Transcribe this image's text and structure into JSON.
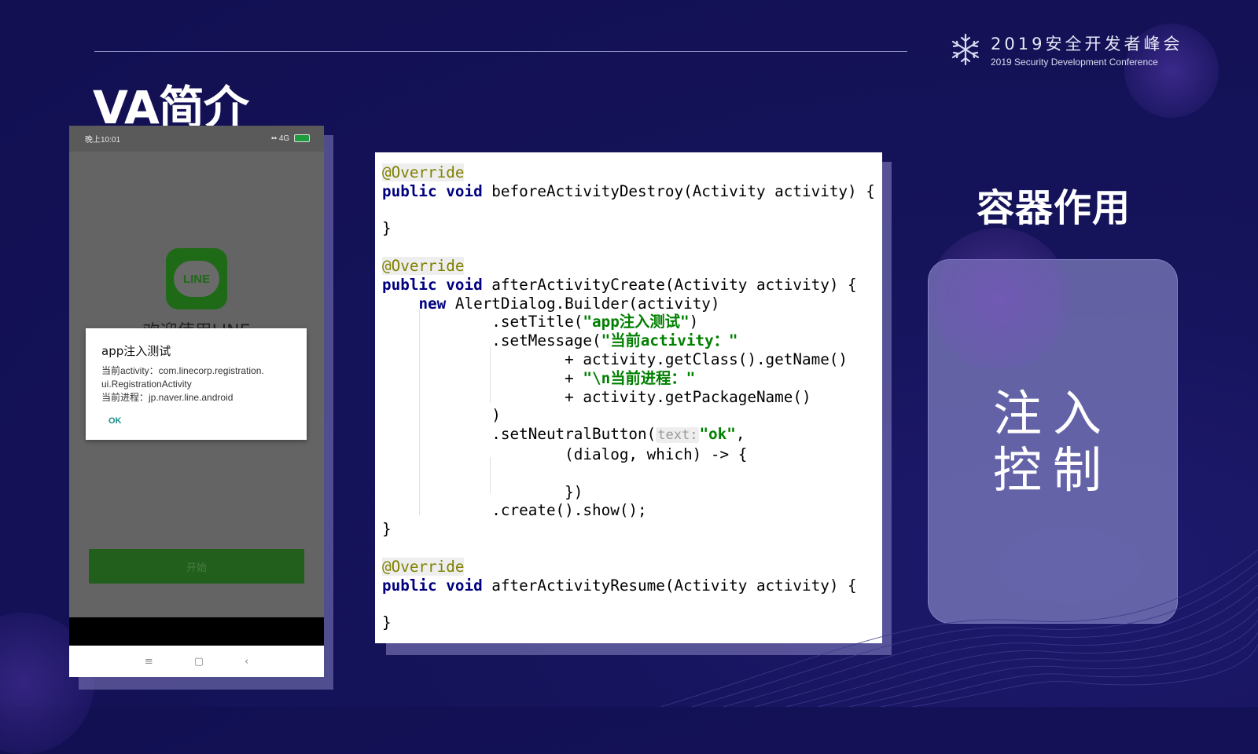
{
  "header": {
    "conference_cn": "2019安全开发者峰会",
    "conference_en": "2019 Security Development Conference"
  },
  "slide": {
    "title": "VA简介",
    "right_title": "容器作用",
    "card_line1": "注入",
    "card_line2": "控制"
  },
  "phone": {
    "status_time": "晚上10:01",
    "status_signal": "4G",
    "battery": "100",
    "app_logo_text": "LINE",
    "welcome_text": "欢迎使用LINE",
    "dialog": {
      "title": "app注入测试",
      "message_line1": "当前activity：com.linecorp.registration.",
      "message_line2": "ui.RegistrationActivity",
      "message_line3": "当前进程：jp.naver.line.android",
      "ok": "OK"
    },
    "start_button": "开始",
    "nav": {
      "menu": "≡",
      "home": "▢",
      "back": "‹"
    }
  },
  "code": {
    "annotation": "@Override",
    "public": "public",
    "void": "void",
    "new": "new",
    "m1": " beforeActivityDestroy(Activity activity) {",
    "close": "}",
    "m2": " afterActivityCreate(Activity activity) {",
    "builder": " AlertDialog.Builder(activity)",
    "set_title": "            .setTitle(",
    "title_str": "\"app注入测试\"",
    "set_title_end": ")",
    "set_message": "            .setMessage(",
    "msg_str": "\"当前activity：\"",
    "plus1": "                    + activity.getClass().getName()",
    "plus2_prefix": "                    + ",
    "proc_str": "\"\\n当前进程：\"",
    "plus3": "                    + activity.getPackageName()",
    "paren": "            )",
    "neutral": "            .setNeutralButton(",
    "hint_text": "text:",
    "ok_str": "\"ok\"",
    "comma": ",",
    "lambda": "                    (dialog, which) -> {",
    "lambda_end": "                    })",
    "create_show": "            .create().show();",
    "m3": " afterActivityResume(Activity activity) {"
  }
}
